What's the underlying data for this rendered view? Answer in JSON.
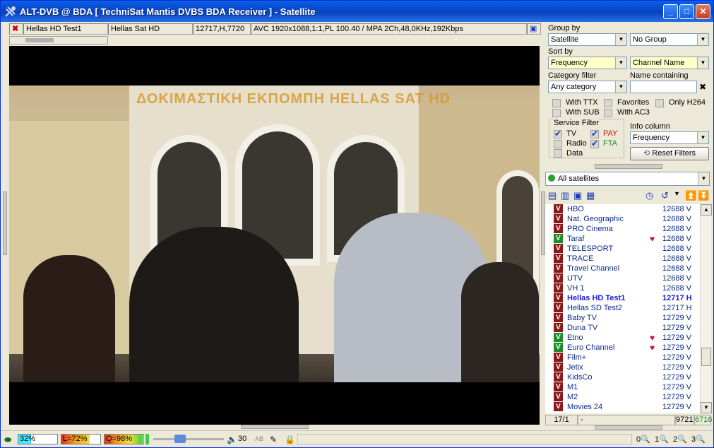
{
  "window": {
    "title": "ALT-DVB @ BDA [ TechniSat Mantis DVBS BDA Receiver ] - Satellite"
  },
  "infobar": {
    "channel": "Hellas HD Test1",
    "satellite": "Hellas Sat HD",
    "transponder": "12717,H,7720",
    "stream": "AVC 1920x1088,1:1,PL 100.40 / MPA 2Ch,48,0KHz,192Kbps"
  },
  "video": {
    "overlay_text": "ΔΟΚΙΜΑΣΤΙΚΗ ΕΚΠΟΜΠΗ HELLAS SAT HD"
  },
  "filters": {
    "group_by_label": "Group by",
    "group_by_value": "Satellite",
    "group_secondary": "No Group",
    "sort_by_label": "Sort by",
    "sort_by_value": "Frequency",
    "sort_secondary": "Channel Name",
    "category_label": "Category filter",
    "category_value": "Any category",
    "name_label": "Name containing",
    "name_value": "",
    "with_ttx": "With TTX",
    "favorites": "Favorites",
    "only_h264": "Only H264",
    "with_sub": "With SUB",
    "with_ac3": "With AC3",
    "service_filter_label": "Service Filter",
    "tv": "TV",
    "pay": "PAY",
    "radio": "Radio",
    "fta": "FTA",
    "data": "Data",
    "info_column_label": "Info column",
    "info_column_value": "Frequency",
    "reset_label": "Reset Filters",
    "satellites": "All satellites"
  },
  "channels": [
    {
      "name": "HBO",
      "freq": "12688 V",
      "fta": false,
      "fav": false,
      "current": false
    },
    {
      "name": "Nat. Geographic",
      "freq": "12688 V",
      "fta": false,
      "fav": false,
      "current": false
    },
    {
      "name": "PRO Cinema",
      "freq": "12688 V",
      "fta": false,
      "fav": false,
      "current": false
    },
    {
      "name": "Taraf",
      "freq": "12688 V",
      "fta": true,
      "fav": true,
      "current": false
    },
    {
      "name": "TELESPORT",
      "freq": "12688 V",
      "fta": false,
      "fav": false,
      "current": false
    },
    {
      "name": "TRACE",
      "freq": "12688 V",
      "fta": false,
      "fav": false,
      "current": false
    },
    {
      "name": "Travel Channel",
      "freq": "12688 V",
      "fta": false,
      "fav": false,
      "current": false
    },
    {
      "name": "UTV",
      "freq": "12688 V",
      "fta": false,
      "fav": false,
      "current": false
    },
    {
      "name": "VH 1",
      "freq": "12688 V",
      "fta": false,
      "fav": false,
      "current": false
    },
    {
      "name": "Hellas HD Test1",
      "freq": "12717 H",
      "fta": false,
      "fav": false,
      "current": true
    },
    {
      "name": "Hellas SD Test2",
      "freq": "12717 H",
      "fta": false,
      "fav": false,
      "current": false
    },
    {
      "name": "Baby TV",
      "freq": "12729 V",
      "fta": false,
      "fav": false,
      "current": false
    },
    {
      "name": "Duna TV",
      "freq": "12729 V",
      "fta": false,
      "fav": false,
      "current": false
    },
    {
      "name": "Etno",
      "freq": "12729 V",
      "fta": true,
      "fav": true,
      "current": false
    },
    {
      "name": "Euro Channel",
      "freq": "12729 V",
      "fta": true,
      "fav": true,
      "current": false
    },
    {
      "name": "Film+",
      "freq": "12729 V",
      "fta": false,
      "fav": false,
      "current": false
    },
    {
      "name": "Jetix",
      "freq": "12729 V",
      "fta": false,
      "fav": false,
      "current": false
    },
    {
      "name": "KidsCo",
      "freq": "12729 V",
      "fta": false,
      "fav": false,
      "current": false
    },
    {
      "name": "M1",
      "freq": "12729 V",
      "fta": false,
      "fav": false,
      "current": false
    },
    {
      "name": "M2",
      "freq": "12729 V",
      "fta": false,
      "fav": false,
      "current": false
    },
    {
      "name": "Movies 24",
      "freq": "12729 V",
      "fta": false,
      "fav": false,
      "current": false
    }
  ],
  "list_footer": {
    "position": "17/1",
    "filter": "-",
    "count": "9721",
    "total": "6716"
  },
  "status": {
    "signal": "32%",
    "level": "L=72%",
    "quality": "Q=98%",
    "volume": "30",
    "zoom0": "0",
    "zoom1": "1",
    "zoom2": "2",
    "zoom3": "3"
  },
  "colors": {
    "title_bar": "#0846c8",
    "pay": "#d01010",
    "fta": "#1f8a2a",
    "favorite": "#d0103a",
    "current_channel": "#1a1ae0"
  }
}
